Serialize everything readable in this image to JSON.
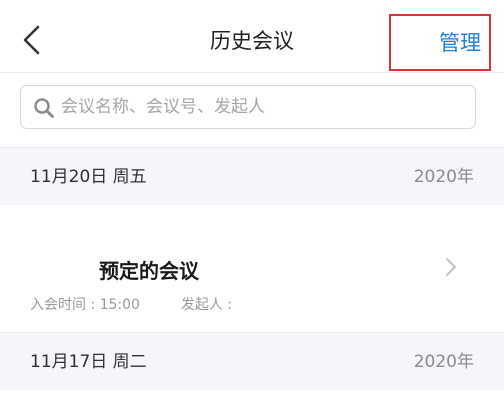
{
  "header": {
    "title": "历史会议",
    "manage_label": "管理"
  },
  "search": {
    "placeholder": "会议名称、会议号、发起人"
  },
  "sections": [
    {
      "date": "11月20日 周五",
      "year": "2020年",
      "meetings": [
        {
          "name": "预定的会议",
          "join_time_label": "入会时间 : 15:00",
          "initiator_label": "发起人 :"
        }
      ]
    },
    {
      "date": "11月17日 周二",
      "year": "2020年"
    }
  ],
  "colors": {
    "accent": "#1e7fd6",
    "highlight_border": "#d8343a",
    "section_bg": "#f4f6fa"
  }
}
